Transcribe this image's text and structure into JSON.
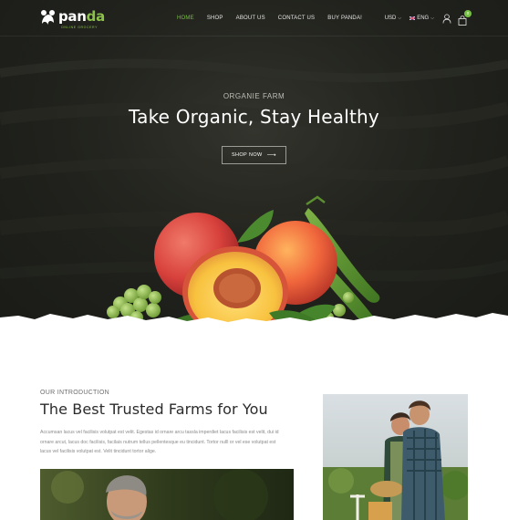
{
  "brand": {
    "name_main": "pan",
    "name_accent": "da",
    "tagline": "ONLINE GROCERY"
  },
  "nav": {
    "items": [
      {
        "label": "HOME",
        "active": true
      },
      {
        "label": "SHOP",
        "active": false
      },
      {
        "label": "ABOUT US",
        "active": false
      },
      {
        "label": "CONTACT US",
        "active": false
      },
      {
        "label": "BUY PANDA!",
        "active": false
      }
    ]
  },
  "header_tools": {
    "currency": "USD",
    "language": "ENG",
    "cart_count": "0"
  },
  "hero": {
    "subtitle": "ORGANIE FARM",
    "title": "Take Organic, Stay Healthy",
    "button_label": "SHOP NOW"
  },
  "intro": {
    "eyebrow": "OUR INTRODUCTION",
    "title": "The Best Trusted Farms for You",
    "body": "Accumsan lacus vel facilisis volutpat est velit. Egestas id ornare arcu tassla imperdiet lacus facilisis est velit, dui id ornare arcut, lacus doc facilisis, facilais nutrum tellus pellentesque eu tincidunt. Tortor nulll or vel ese volutpat est lacus vel facilisis volutpat est. Velit tincidunt tortor alige."
  },
  "colors": {
    "accent": "#76c043",
    "hero_bg": "#22231e",
    "heading": "#2b2b2b",
    "body_text": "#8a8a8a"
  }
}
